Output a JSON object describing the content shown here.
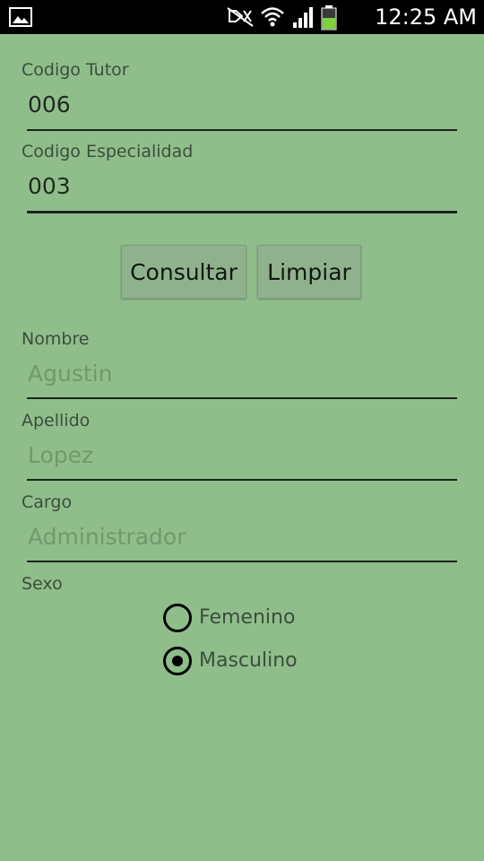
{
  "status_bar": {
    "time": "12:25 AM",
    "icons": [
      "gallery-icon",
      "mute-icon",
      "wifi-icon",
      "signal-icon",
      "battery-icon"
    ]
  },
  "form": {
    "codigo_tutor": {
      "label": "Codigo Tutor",
      "value": "006"
    },
    "codigo_especialidad": {
      "label": "Codigo Especialidad",
      "value": "003"
    },
    "buttons": {
      "consultar": "Consultar",
      "limpiar": "Limpiar"
    },
    "nombre": {
      "label": "Nombre",
      "hint": "Agustin"
    },
    "apellido": {
      "label": "Apellido",
      "hint": "Lopez"
    },
    "cargo": {
      "label": "Cargo",
      "hint": "Administrador"
    },
    "sexo": {
      "label": "Sexo",
      "options": [
        {
          "label": "Femenino",
          "selected": false
        },
        {
          "label": "Masculino",
          "selected": true
        }
      ]
    }
  },
  "colors": {
    "background": "#8fbe8b",
    "status_bar": "#000000",
    "battery_fill": "#7fd13b"
  }
}
